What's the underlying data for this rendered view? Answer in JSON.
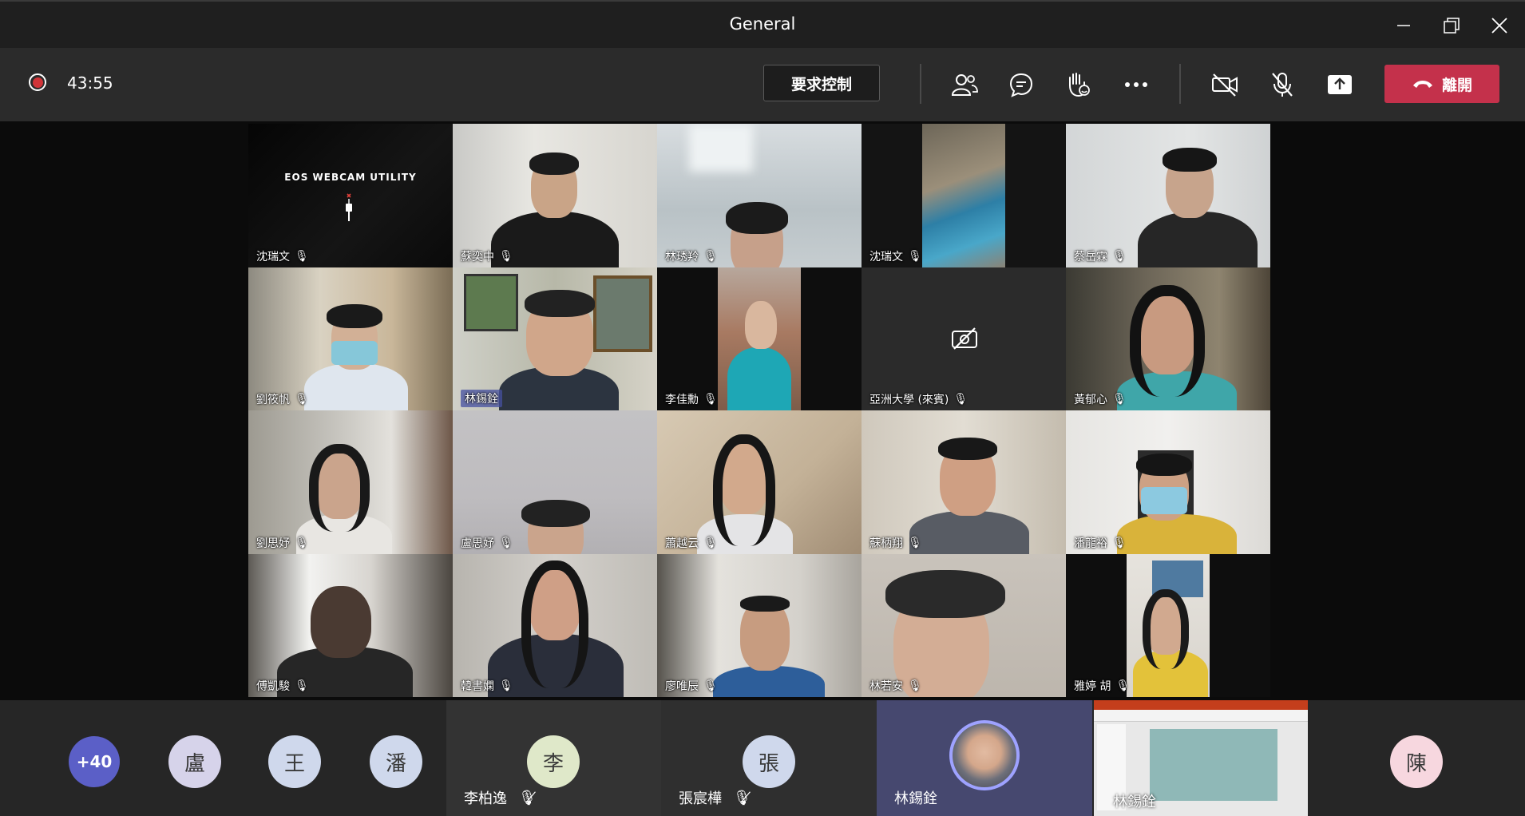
{
  "window": {
    "title": "General"
  },
  "toolbar": {
    "timer": "43:55",
    "request_control_label": "要求控制",
    "leave_label": "離開"
  },
  "tiles": [
    {
      "name": "沈瑞文",
      "overlay_text": "EOS WEBCAM UTILITY"
    },
    {
      "name": "蘇奕中"
    },
    {
      "name": "林琇羚"
    },
    {
      "name": "沈瑞文"
    },
    {
      "name": "蔡岳霖"
    },
    {
      "name": "劉筱帆"
    },
    {
      "name": "林錫銓"
    },
    {
      "name": "李佳勳"
    },
    {
      "name": "亞洲大學 (來賓)"
    },
    {
      "name": "黃郁心"
    },
    {
      "name": "劉思妤"
    },
    {
      "name": "盧思妤"
    },
    {
      "name": "蕭越云"
    },
    {
      "name": "蘇柄翔"
    },
    {
      "name": "潘龍裕"
    },
    {
      "name": "傅凱駿"
    },
    {
      "name": "韓書嫻"
    },
    {
      "name": "廖唯辰"
    },
    {
      "name": "林若安"
    },
    {
      "name": "雅婷 胡"
    }
  ],
  "strip": {
    "overflow_count": "+40",
    "avatars": [
      "盧",
      "王",
      "潘",
      "陳"
    ],
    "cards": [
      {
        "initial": "李",
        "name": "李柏逸"
      },
      {
        "initial": "張",
        "name": "張宸樺"
      },
      {
        "name": "林錫銓"
      },
      {
        "name": "林錫銓"
      }
    ]
  },
  "colors": {
    "leave": "#c4314b",
    "recording": "#d13438",
    "overflow_avatar": "#5b5fc7",
    "active_speaker": "#4f52b2"
  },
  "icons": [
    "record-icon",
    "minimize-icon",
    "restore-icon",
    "close-icon",
    "participants-icon",
    "chat-icon",
    "raise-hand-icon",
    "more-icon",
    "camera-off-icon",
    "mic-off-icon",
    "share-icon",
    "phone-hangup-icon",
    "mic-icon",
    "video-off-icon"
  ]
}
